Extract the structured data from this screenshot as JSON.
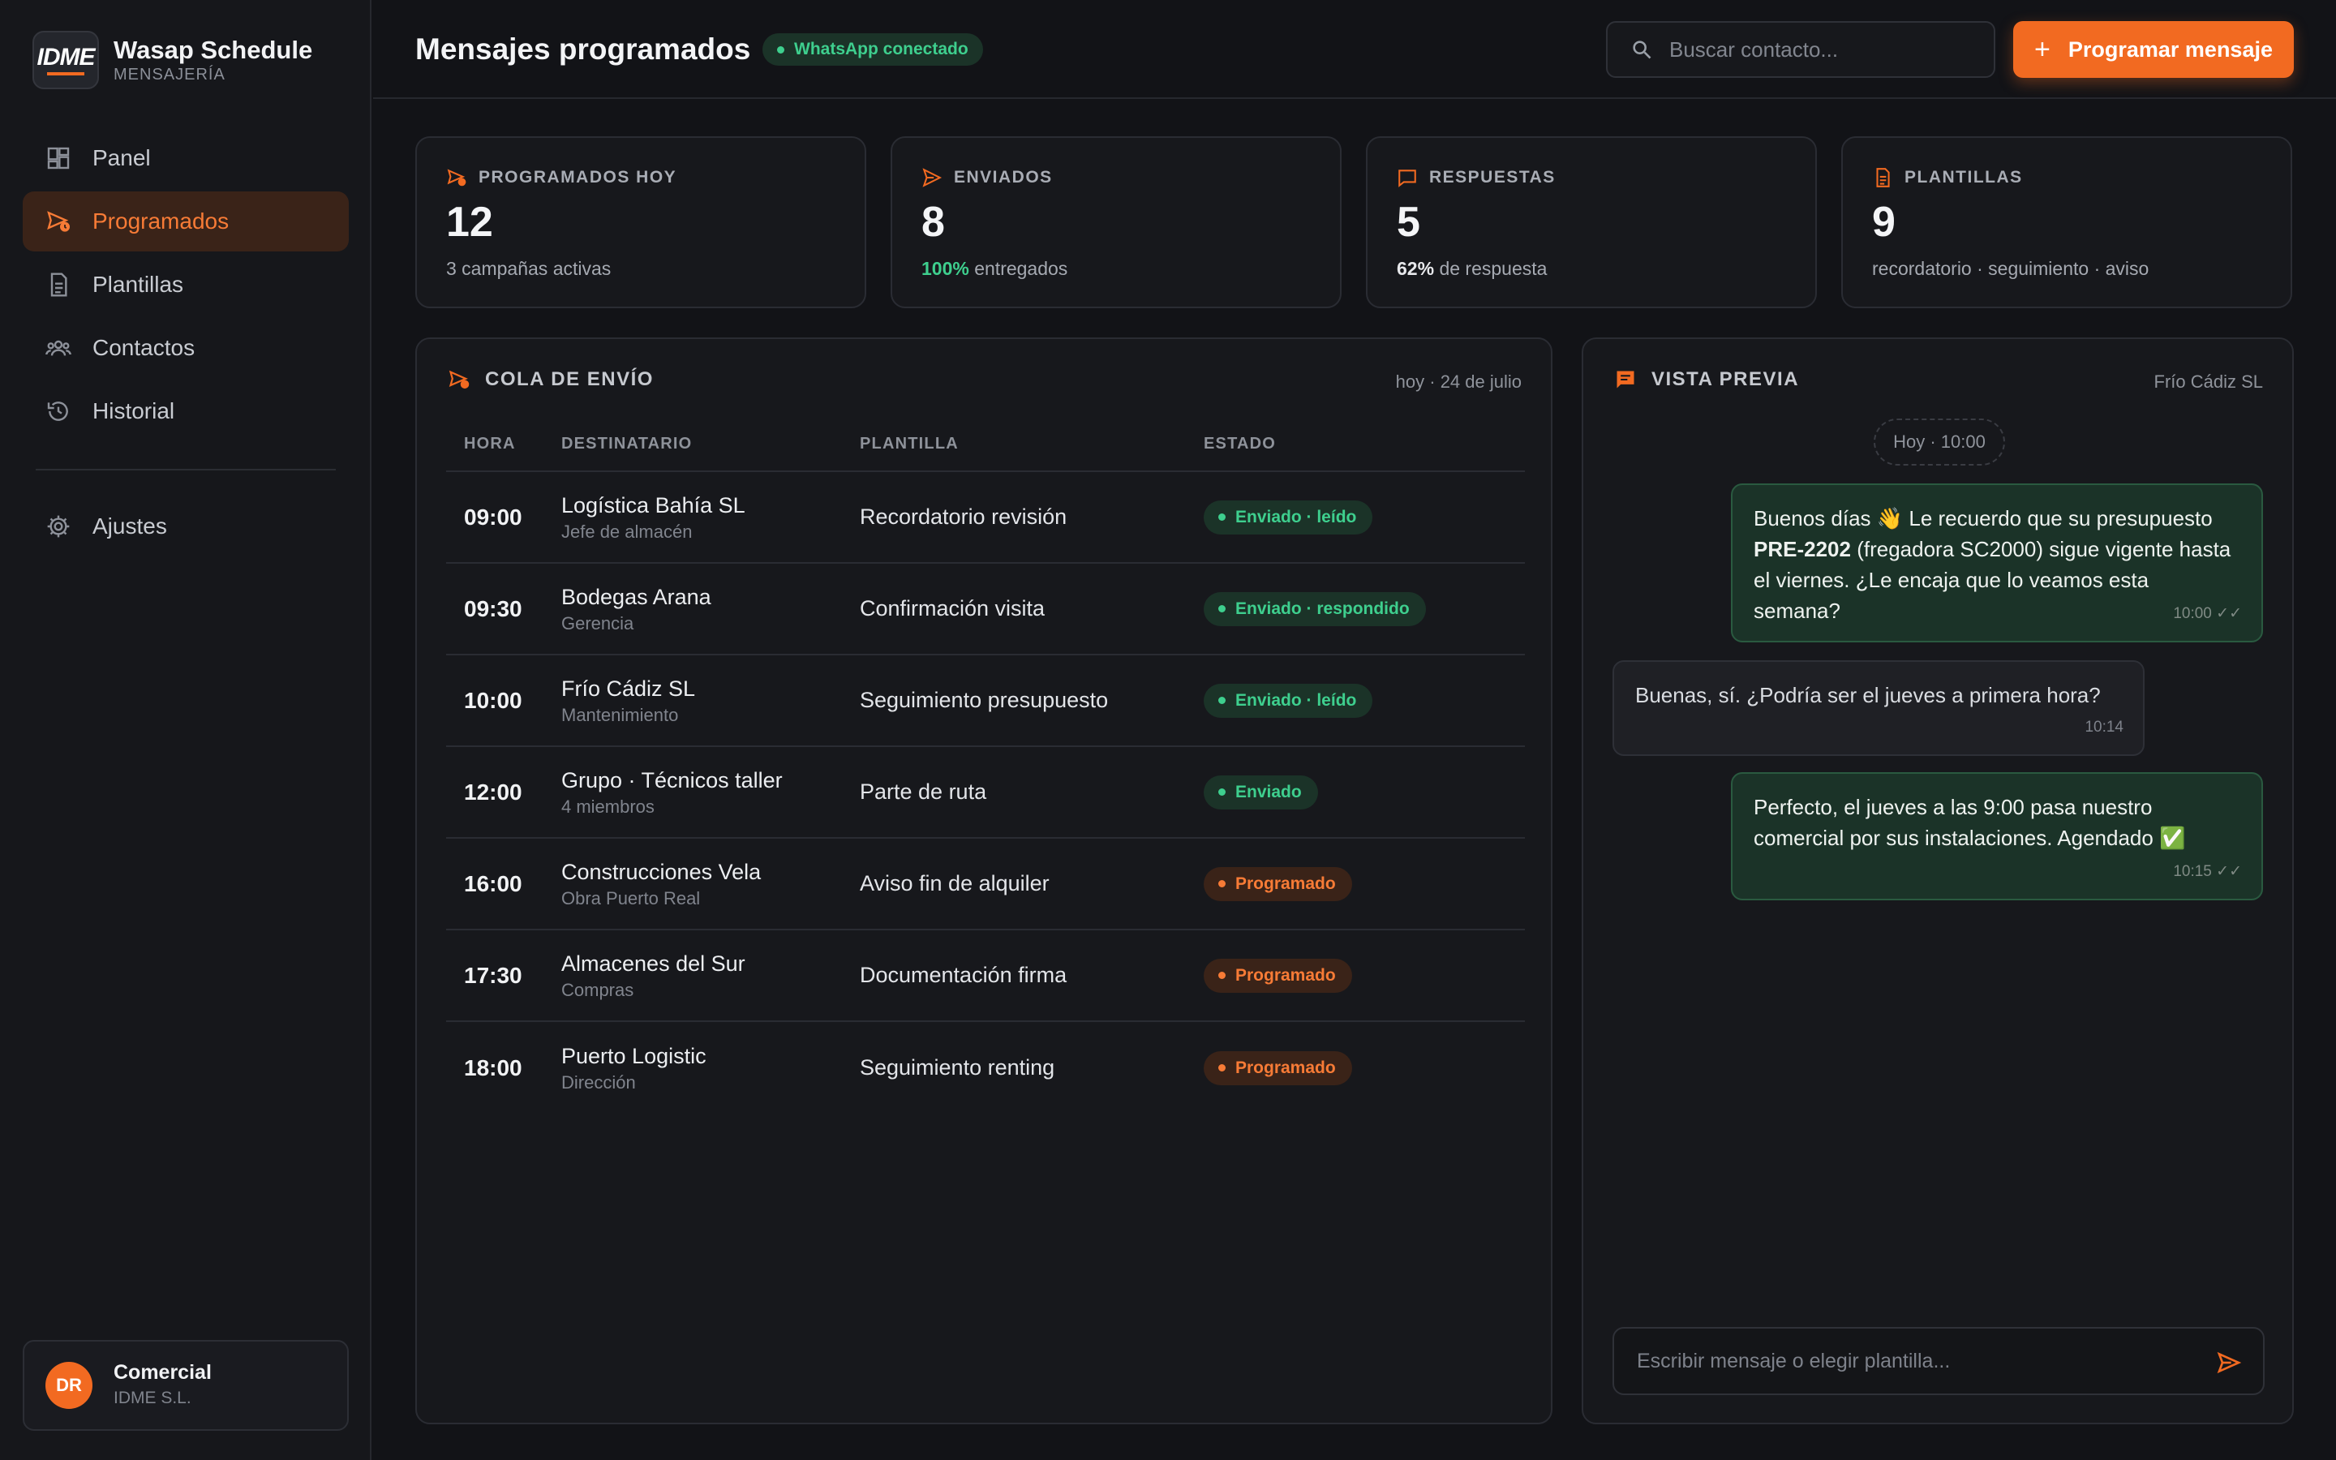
{
  "brand": {
    "logo": "IDME",
    "title": "Wasap Schedule",
    "subtitle": "MENSAJERÍA"
  },
  "nav": [
    {
      "label": "Panel",
      "icon": "dashboard-icon"
    },
    {
      "label": "Programados",
      "icon": "scheduled-send-icon",
      "active": true
    },
    {
      "label": "Plantillas",
      "icon": "document-icon"
    },
    {
      "label": "Contactos",
      "icon": "people-icon"
    },
    {
      "label": "Historial",
      "icon": "history-icon"
    },
    {
      "label": "Ajustes",
      "icon": "gear-icon"
    }
  ],
  "user": {
    "initials": "DR",
    "name": "Comercial",
    "org": "IDME S.L."
  },
  "header": {
    "title": "Mensajes programados",
    "status_badge": "WhatsApp conectado",
    "search_placeholder": "Buscar contacto...",
    "cta_label": "Programar mensaje"
  },
  "stats": [
    {
      "label": "PROGRAMADOS HOY",
      "value": "12",
      "sub": "3 campañas activas",
      "icon": "scheduled-send-icon"
    },
    {
      "label": "ENVIADOS",
      "value": "8",
      "sub_strong": "100%",
      "sub": "entregados",
      "icon": "send-icon"
    },
    {
      "label": "RESPUESTAS",
      "value": "5",
      "sub_strong": "62%",
      "sub": "de respuesta",
      "icon": "chat-icon"
    },
    {
      "label": "PLANTILLAS",
      "value": "9",
      "sub": "recordatorio · seguimiento · aviso",
      "icon": "document-icon"
    }
  ],
  "queue": {
    "title": "COLA DE ENVÍO",
    "date": "hoy · 24 de julio",
    "columns": [
      "HORA",
      "DESTINATARIO",
      "PLANTILLA",
      "ESTADO"
    ],
    "rows": [
      {
        "time": "09:00",
        "name": "Logística Bahía SL",
        "sub": "Jefe de almacén",
        "template": "Recordatorio revisión",
        "status": "Enviado · leído",
        "kind": "sent"
      },
      {
        "time": "09:30",
        "name": "Bodegas Arana",
        "sub": "Gerencia",
        "template": "Confirmación visita",
        "status": "Enviado · respondido",
        "kind": "sent"
      },
      {
        "time": "10:00",
        "name": "Frío Cádiz SL",
        "sub": "Mantenimiento",
        "template": "Seguimiento presupuesto",
        "status": "Enviado · leído",
        "kind": "sent"
      },
      {
        "time": "12:00",
        "name": "Grupo · Técnicos taller",
        "sub": "4 miembros",
        "template": "Parte de ruta",
        "status": "Enviado",
        "kind": "sent"
      },
      {
        "time": "16:00",
        "name": "Construcciones Vela",
        "sub": "Obra Puerto Real",
        "template": "Aviso fin de alquiler",
        "status": "Programado",
        "kind": "sched"
      },
      {
        "time": "17:30",
        "name": "Almacenes del Sur",
        "sub": "Compras",
        "template": "Documentación firma",
        "status": "Programado",
        "kind": "sched"
      },
      {
        "time": "18:00",
        "name": "Puerto Logistic",
        "sub": "Dirección",
        "template": "Seguimiento renting",
        "status": "Programado",
        "kind": "sched"
      }
    ]
  },
  "preview": {
    "title": "VISTA PREVIA",
    "contact": "Frío Cádiz SL",
    "day": "Hoy · 10:00",
    "messages": [
      {
        "dir": "out",
        "text_a": "Buenos días 👋 Le recuerdo que su presupuesto",
        "text_bold": "PRE-2202",
        "text_b": "(fregadora SC2000) sigue vigente hasta el viernes. ¿Le encaja que lo veamos esta semana?",
        "time": "10:00 ✓✓"
      },
      {
        "dir": "in",
        "text": "Buenas, sí. ¿Podría ser el jueves a primera hora?",
        "time": "10:14"
      },
      {
        "dir": "out",
        "text": "Perfecto, el jueves a las 9:00 pasa nuestro comercial por sus instalaciones. Agendado ✅",
        "time": "10:15 ✓✓"
      }
    ],
    "composer_placeholder": "Escribir mensaje o elegir plantilla..."
  },
  "colors": {
    "accent": "#f26a21",
    "success": "#3ecf8e",
    "background": "#121317",
    "panel": "#17181c"
  }
}
